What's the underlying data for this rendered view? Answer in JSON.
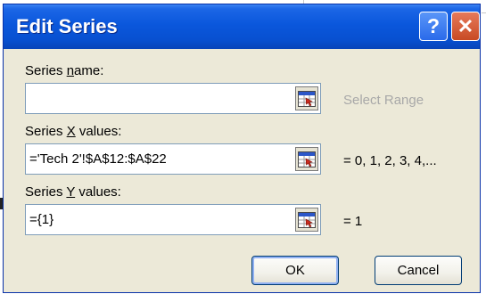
{
  "dialog": {
    "title": "Edit Series",
    "help_glyph": "?",
    "close_glyph": "✕"
  },
  "fields": {
    "name": {
      "label_prefix": "Series ",
      "label_key": "n",
      "label_suffix": "ame:",
      "value": "",
      "preview": "Select Range"
    },
    "x": {
      "label_prefix": "Series ",
      "label_key": "X",
      "label_suffix": " values:",
      "value": "='Tech 2'!$A$12:$A$22",
      "preview": "= 0, 1, 2, 3, 4,..."
    },
    "y": {
      "label_prefix": "Series ",
      "label_key": "Y",
      "label_suffix": " values:",
      "value": "={1}",
      "preview": "= 1"
    }
  },
  "buttons": {
    "ok": "OK",
    "cancel": "Cancel"
  },
  "icons": {
    "title_buttons": [
      "help-icon",
      "close-icon"
    ],
    "range_button": "range-select-icon"
  },
  "colors": {
    "titlebar": "#0a57dc",
    "dialog_bg": "#ece9d8",
    "close_button": "#d4553a",
    "field_border": "#7f9db9",
    "dim_text": "#a8a8a8"
  }
}
